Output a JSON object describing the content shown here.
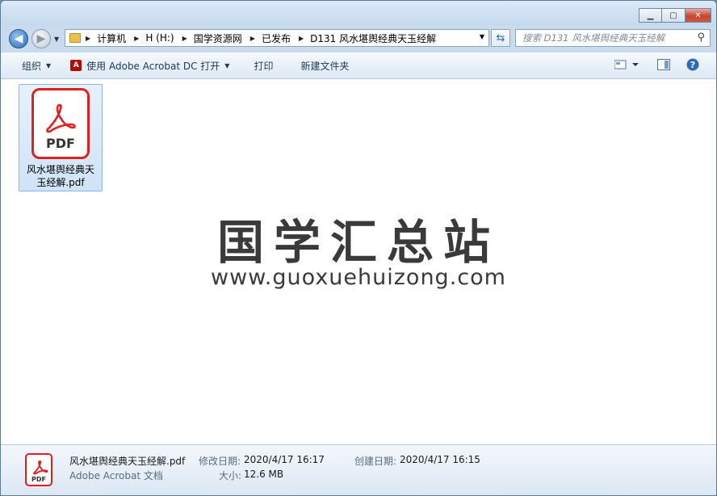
{
  "window": {
    "buttons": {
      "minimize": "▁",
      "maximize": "▢",
      "close": "✕"
    }
  },
  "address_bar": {
    "path": [
      "计算机",
      "H (H:)",
      "国学资源网",
      "已发布",
      "D131 风水堪舆经典天玉经解"
    ]
  },
  "search": {
    "placeholder": "搜索 D131 风水堪舆经典天玉经解"
  },
  "toolbar": {
    "organize": "组织",
    "open_with": "使用 Adobe Acrobat DC 打开",
    "print": "打印",
    "new_folder": "新建文件夹"
  },
  "file": {
    "icon_label": "PDF",
    "name_line1": "风水堪舆经典天",
    "name_line2": "玉经解.pdf"
  },
  "watermark": {
    "title": "国学汇总站",
    "url": "www.guoxuehuizong.com"
  },
  "details": {
    "icon_label": "PDF",
    "filename": "风水堪舆经典天玉经解.pdf",
    "filetype": "Adobe Acrobat 文档",
    "modified_label": "修改日期:",
    "modified_value": "2020/4/17 16:17",
    "created_label": "创建日期:",
    "created_value": "2020/4/17 16:15",
    "size_label": "大小:",
    "size_value": "12.6 MB"
  },
  "colors": {
    "accent": "#2c6db3",
    "pdf_red": "#e02020",
    "close_red": "#c7452e"
  }
}
